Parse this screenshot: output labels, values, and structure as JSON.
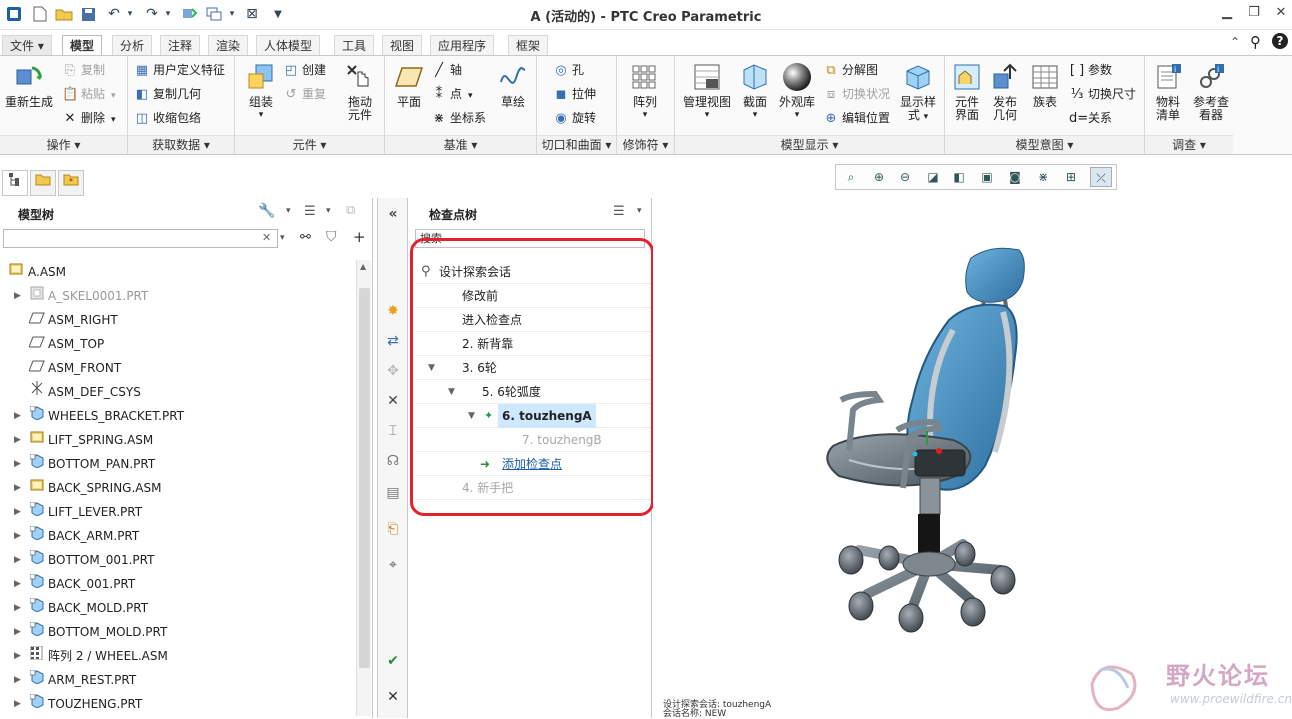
{
  "window": {
    "title": "A (活动的) - PTC Creo Parametric"
  },
  "tabs": [
    {
      "label": "文件 ▾"
    },
    {
      "label": "模型"
    },
    {
      "label": "分析"
    },
    {
      "label": "注释"
    },
    {
      "label": "渲染"
    },
    {
      "label": "人体模型"
    },
    {
      "label": "工具"
    },
    {
      "label": "视图"
    },
    {
      "label": "应用程序"
    },
    {
      "label": "框架"
    }
  ],
  "ribbon": {
    "groups": [
      {
        "label": "操作 ▾"
      },
      {
        "label": "获取数据 ▾"
      },
      {
        "label": "元件 ▾"
      },
      {
        "label": "基准 ▾"
      },
      {
        "label": "切口和曲面 ▾"
      },
      {
        "label": "修饰符 ▾"
      },
      {
        "label": "模型显示 ▾"
      },
      {
        "label": "模型意图 ▾"
      },
      {
        "label": "调查 ▾"
      }
    ],
    "regenerate": "重新生成",
    "copy": "复制",
    "paste": "粘贴",
    "delete": "删除",
    "user_feature": "用户定义特征",
    "copy_geometry": "复制几何",
    "shrinkwrap": "收缩包络",
    "assemble": "组装",
    "create": "创建",
    "repeat": "重复",
    "drag_component_1": "拖动",
    "drag_component_2": "元件",
    "plane": "平面",
    "axis": "轴",
    "point": "点",
    "csys": "坐标系",
    "sketch": "草绘",
    "hole": "孔",
    "extrude": "拉伸",
    "revolve": "旋转",
    "pattern": "阵列",
    "manage_views": "管理视图",
    "section": "截面",
    "appearance": "外观库",
    "explode_view": "分解图",
    "toggle_status": "切换状况",
    "edit_position": "编辑位置",
    "display_style_1": "显示样",
    "display_style_2": "式",
    "component_ui_1": "元件",
    "component_ui_2": "界面",
    "publish_geom_1": "发布",
    "publish_geom_2": "几何",
    "family_table": "族表",
    "parameters": "参数",
    "switch_dimensions": "切换尺寸",
    "relations": "关系",
    "bom_1": "物料",
    "bom_2": "清单",
    "ref_viewer_1": "参考查",
    "ref_viewer_2": "看器"
  },
  "model_tree": {
    "title": "模型树",
    "search_value": "",
    "items": [
      {
        "label": "A.ASM",
        "icon": "assembly-icon",
        "expand": ""
      },
      {
        "label": "A_SKEL0001.PRT",
        "icon": "skeleton-icon",
        "expand": "▶"
      },
      {
        "label": "ASM_RIGHT",
        "icon": "datum-plane-icon",
        "expand": ""
      },
      {
        "label": "ASM_TOP",
        "icon": "datum-plane-icon",
        "expand": ""
      },
      {
        "label": "ASM_FRONT",
        "icon": "datum-plane-icon",
        "expand": ""
      },
      {
        "label": "ASM_DEF_CSYS",
        "icon": "csys-icon",
        "expand": ""
      },
      {
        "label": "WHEELS_BRACKET.PRT",
        "icon": "part-icon",
        "expand": "▶"
      },
      {
        "label": "LIFT_SPRING.ASM",
        "icon": "assembly-icon",
        "expand": "▶"
      },
      {
        "label": "BOTTOM_PAN.PRT",
        "icon": "part-icon",
        "expand": "▶"
      },
      {
        "label": "BACK_SPRING.ASM",
        "icon": "assembly-icon",
        "expand": "▶"
      },
      {
        "label": "LIFT_LEVER.PRT",
        "icon": "part-icon",
        "expand": "▶"
      },
      {
        "label": "BACK_ARM.PRT",
        "icon": "part-icon",
        "expand": "▶"
      },
      {
        "label": "BOTTOM_001.PRT",
        "icon": "part-icon",
        "expand": "▶"
      },
      {
        "label": "BACK_001.PRT",
        "icon": "part-icon",
        "expand": "▶"
      },
      {
        "label": "BACK_MOLD.PRT",
        "icon": "part-icon",
        "expand": "▶"
      },
      {
        "label": "BOTTOM_MOLD.PRT",
        "icon": "part-icon",
        "expand": "▶"
      },
      {
        "label": "阵列 2 / WHEEL.ASM",
        "icon": "pattern-icon",
        "expand": "▶"
      },
      {
        "label": "ARM_REST.PRT",
        "icon": "part-icon",
        "expand": "▶"
      },
      {
        "label": "TOUZHENG.PRT",
        "icon": "part-icon",
        "expand": "▶"
      }
    ]
  },
  "checkpoint_tree": {
    "title": "检查点树",
    "search_placeholder": "搜索",
    "items": [
      {
        "label": "设计探索会话",
        "indent": 0,
        "style": "normal",
        "expand": ""
      },
      {
        "label": "修改前",
        "indent": 1,
        "style": "normal",
        "expand": ""
      },
      {
        "label": "进入检查点",
        "indent": 1,
        "style": "normal",
        "expand": ""
      },
      {
        "label": "2. 新背靠",
        "indent": 1,
        "style": "normal",
        "expand": ""
      },
      {
        "label": "3. 6轮",
        "indent": 1,
        "style": "normal",
        "expand": "▼"
      },
      {
        "label": "5. 6轮弧度",
        "indent": 2,
        "style": "normal",
        "expand": "▼"
      },
      {
        "label": "6. touzhengA",
        "indent": 3,
        "style": "active",
        "expand": "▼"
      },
      {
        "label": "7. touzhengB",
        "indent": 4,
        "style": "disabled",
        "expand": ""
      },
      {
        "label": "添加检查点",
        "indent": 3,
        "style": "link",
        "expand": ""
      },
      {
        "label": "4. 新手把",
        "indent": 1,
        "style": "disabled",
        "expand": ""
      }
    ]
  },
  "status": {
    "line1": "设计探索会话: touzhengA",
    "line2": "会话名称: NEW"
  },
  "watermark": {
    "title": "野火论坛",
    "url": "www.proewildfire.cn"
  },
  "colors": {
    "highlight": "#cde8ff",
    "red_box": "#e3202c",
    "link": "#1a5fa8"
  }
}
